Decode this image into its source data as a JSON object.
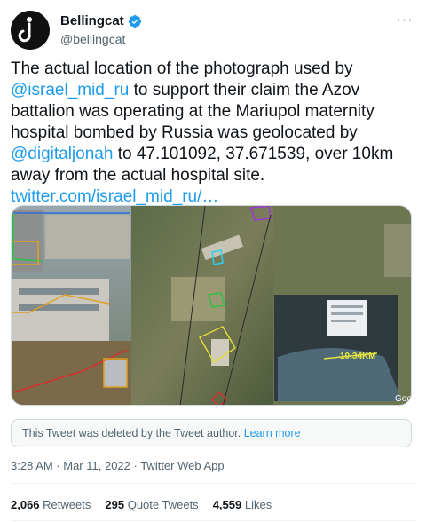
{
  "author": {
    "display_name": "Bellingcat",
    "handle": "@bellingcat"
  },
  "more_label": "···",
  "tweet": {
    "text_part1": "The actual location of the photograph used by ",
    "mention1": "@israel_mid_ru",
    "text_part2": " to support their claim the Azov battalion was operating at the Mariupol maternity hospital bombed by Russia was geolocated by ",
    "mention2": "@digitaljonah",
    "text_part3": " to 47.101092, 37.671539, over 10km away from the actual hospital site.",
    "link": "twitter.com/israel_mid_ru/…"
  },
  "media": {
    "distance_label": "10.34KM",
    "map_credit": "Goo"
  },
  "deleted_notice": {
    "text": "This Tweet was deleted by the Tweet author.",
    "learn_more": "Learn more"
  },
  "meta": {
    "timestamp": "3:28 AM · Mar 11, 2022 · Twitter Web App"
  },
  "stats": {
    "retweets_count": "2,066",
    "retweets_label": "Retweets",
    "quotes_count": "295",
    "quotes_label": "Quote Tweets",
    "likes_count": "4,559",
    "likes_label": "Likes"
  },
  "colors": {
    "link": "#1d9bf0",
    "verified": "#1d9bf0",
    "muted": "#536471"
  }
}
